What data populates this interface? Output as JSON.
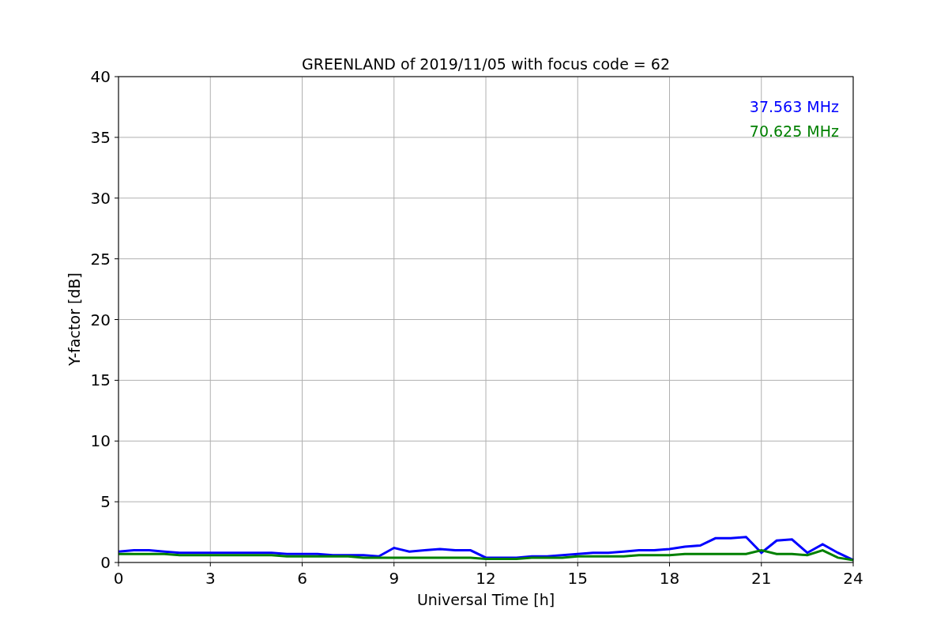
{
  "chart_data": {
    "type": "line",
    "title": "GREENLAND of 2019/11/05 with focus code = 62",
    "xlabel": "Universal Time [h]",
    "ylabel": "Y-factor [dB]",
    "x": [
      0,
      0.5,
      1,
      1.5,
      2,
      2.5,
      3,
      3.5,
      4,
      4.5,
      5,
      5.5,
      6,
      6.5,
      7,
      7.5,
      8,
      8.5,
      9,
      9.5,
      10,
      10.5,
      11,
      11.5,
      12,
      12.5,
      13,
      13.5,
      14,
      14.5,
      15,
      15.5,
      16,
      16.5,
      17,
      17.5,
      18,
      18.5,
      19,
      19.5,
      20,
      20.5,
      21,
      21.5,
      22,
      22.5,
      23,
      23.5,
      24
    ],
    "series": [
      {
        "name": "37.563 MHz",
        "color": "#0000ff",
        "values": [
          0.9,
          1.0,
          1.0,
          0.9,
          0.8,
          0.8,
          0.8,
          0.8,
          0.8,
          0.8,
          0.8,
          0.7,
          0.7,
          0.7,
          0.6,
          0.6,
          0.6,
          0.5,
          1.2,
          0.9,
          1.0,
          1.1,
          1.0,
          1.0,
          0.4,
          0.4,
          0.4,
          0.5,
          0.5,
          0.6,
          0.7,
          0.8,
          0.8,
          0.9,
          1.0,
          1.0,
          1.1,
          1.3,
          1.4,
          2.0,
          2.0,
          2.1,
          0.8,
          1.8,
          1.9,
          0.8,
          1.5,
          0.8,
          0.2
        ]
      },
      {
        "name": "70.625 MHz",
        "color": "#008000",
        "values": [
          0.7,
          0.7,
          0.7,
          0.7,
          0.6,
          0.6,
          0.6,
          0.6,
          0.6,
          0.6,
          0.6,
          0.5,
          0.5,
          0.5,
          0.5,
          0.5,
          0.4,
          0.4,
          0.4,
          0.4,
          0.4,
          0.4,
          0.4,
          0.4,
          0.3,
          0.3,
          0.3,
          0.4,
          0.4,
          0.4,
          0.5,
          0.5,
          0.5,
          0.5,
          0.6,
          0.6,
          0.6,
          0.7,
          0.7,
          0.7,
          0.7,
          0.7,
          1.0,
          0.7,
          0.7,
          0.6,
          1.0,
          0.4,
          0.2
        ]
      }
    ],
    "grid": true,
    "xlim": [
      0,
      24
    ],
    "ylim": [
      0,
      40
    ],
    "xticks": [
      0,
      3,
      6,
      9,
      12,
      15,
      18,
      21,
      24
    ],
    "yticks": [
      0,
      5,
      10,
      15,
      20,
      25,
      30,
      35,
      40
    ]
  }
}
